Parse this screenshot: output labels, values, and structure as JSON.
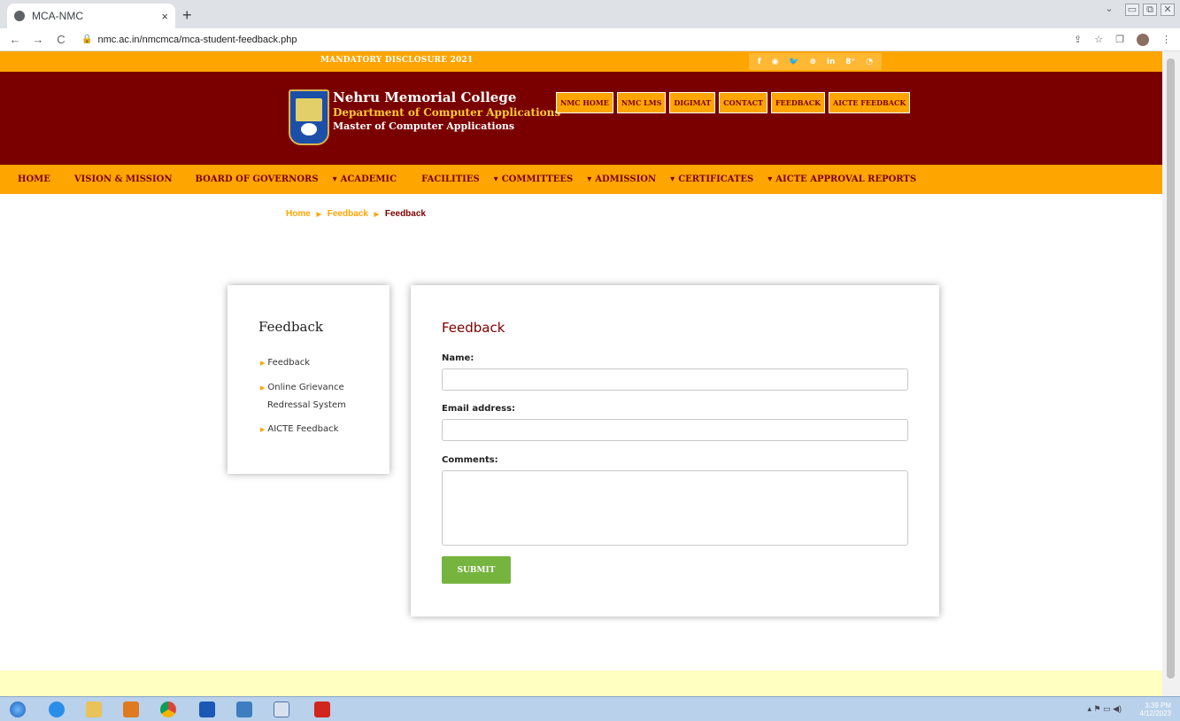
{
  "browser": {
    "tab_title": "MCA-NMC",
    "tab_close": "×",
    "new_tab": "+",
    "url": "nmc.ac.in/nmcmca/mca-student-feedback.php",
    "back": "←",
    "forward": "→",
    "reload": "C",
    "lock": "🔒",
    "toolbar_icons": [
      "⇪",
      "☆",
      "❐",
      "⋮"
    ],
    "window_controls": [
      "⌄",
      "▭",
      "⧉",
      "✕"
    ]
  },
  "top_strip": {
    "mandatory": "MANDATORY DISCLOSURE 2021",
    "social_icons": [
      "f",
      "◉",
      "🐦",
      "⊕",
      "in",
      "8⁺",
      "◔"
    ]
  },
  "header": {
    "college_name": "Nehru Memorial College",
    "department": "Department of Computer Applications",
    "program": "Master of Computer Applications",
    "nav_buttons": [
      "NMC HOME",
      "NMC LMS",
      "DIGIMAT",
      "CONTACT",
      "FEEDBACK",
      "AICTE FEEDBACK"
    ]
  },
  "menu": [
    {
      "label": "HOME",
      "dropdown": false
    },
    {
      "label": "VISION & MISSION",
      "dropdown": false
    },
    {
      "label": "BOARD OF GOVERNORS",
      "dropdown": false
    },
    {
      "label": "ACADEMIC",
      "dropdown": true
    },
    {
      "label": "FACILITIES",
      "dropdown": false
    },
    {
      "label": "COMMITTEES",
      "dropdown": true
    },
    {
      "label": "ADMISSION",
      "dropdown": true
    },
    {
      "label": "CERTIFICATES",
      "dropdown": true
    },
    {
      "label": "AICTE APPROVAL REPORTS",
      "dropdown": true
    }
  ],
  "breadcrumb": [
    "Home",
    "Feedback",
    "Feedback"
  ],
  "sidebar": {
    "title": "Feedback",
    "items": [
      "Feedback",
      "Online Grievance",
      "Redressal System",
      "AICTE Feedback"
    ]
  },
  "form": {
    "title": "Feedback",
    "name_label": "Name:",
    "name_value": "",
    "email_label": "Email address:",
    "email_value": "",
    "comments_label": "Comments:",
    "comments_value": "",
    "submit_label": "SUBMIT"
  },
  "taskbar": {
    "time": "3:39 PM",
    "date": "4/12/2023",
    "tray_icons": "▴ ⚑ ▭ ◀)"
  },
  "colors": {
    "maroon": "#7a0000",
    "orange": "#ffa500",
    "submit_green": "#75b43e"
  }
}
